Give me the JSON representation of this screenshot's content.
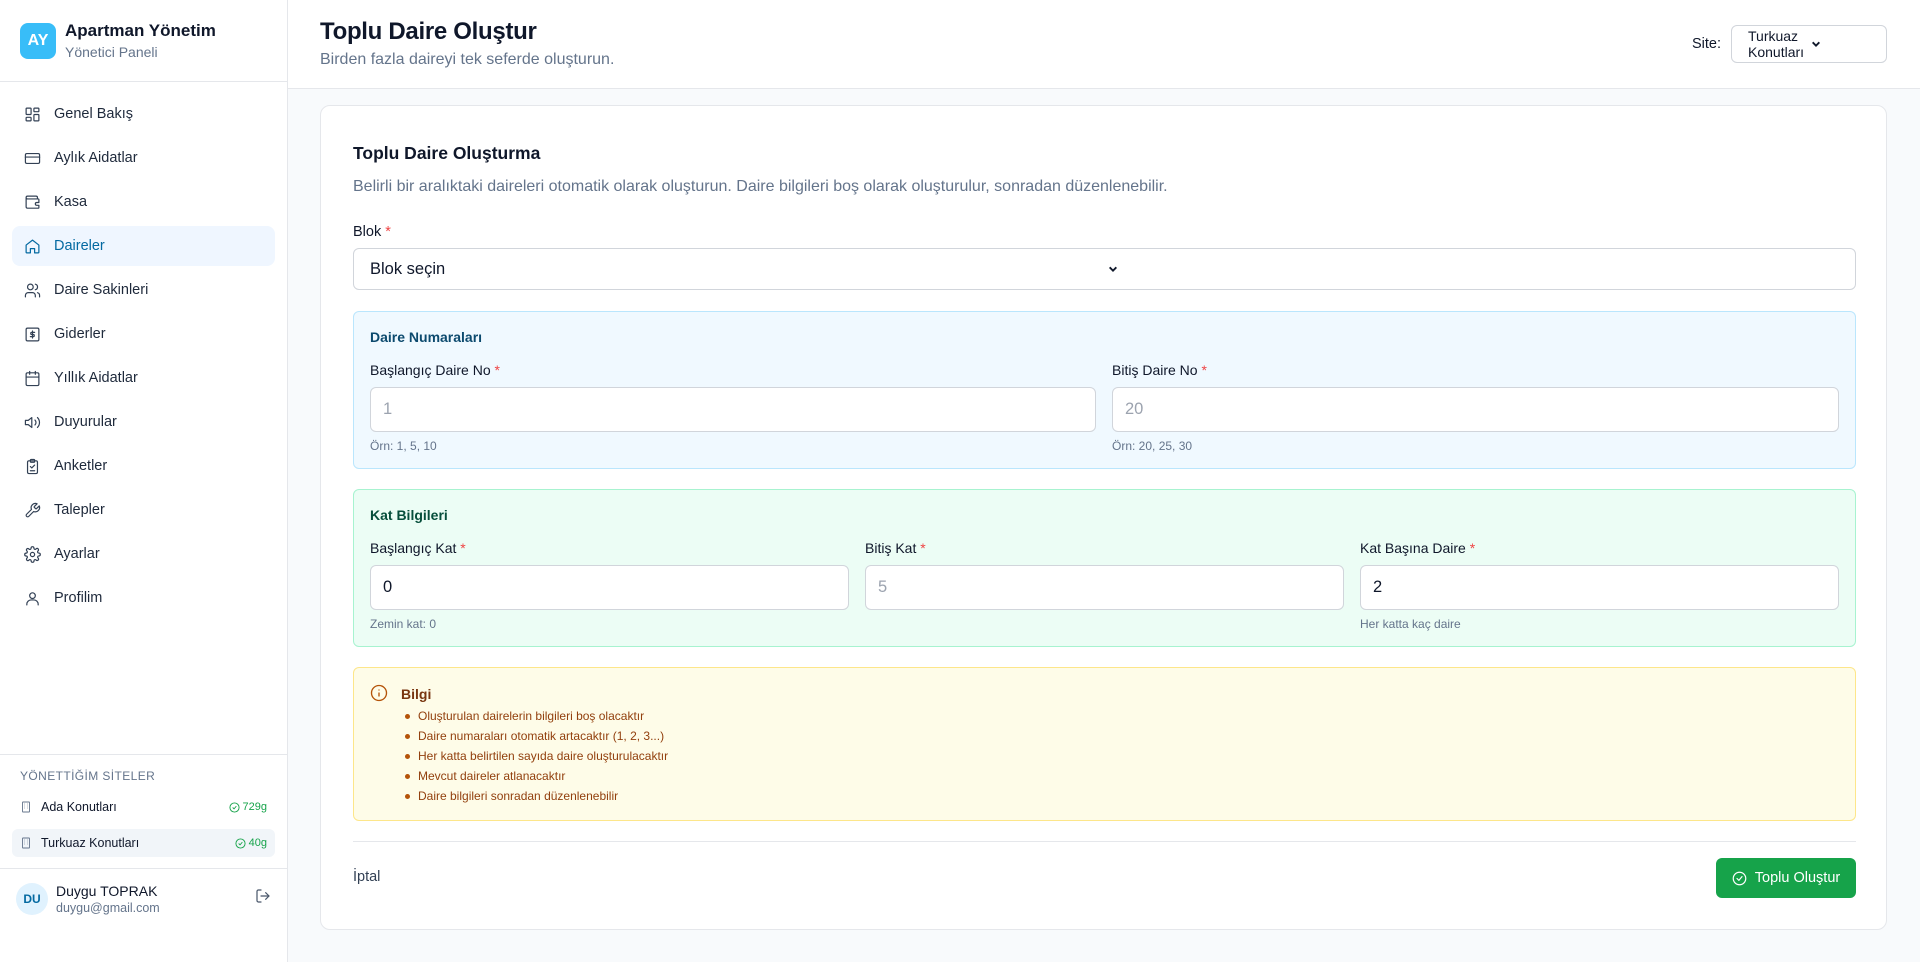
{
  "brand": {
    "initials": "AY",
    "title": "Apartman Yönetim",
    "subtitle": "Yönetici Paneli"
  },
  "sidebar": {
    "items": [
      {
        "label": "Genel Bakış",
        "icon": "dashboard-icon"
      },
      {
        "label": "Aylık Aidatlar",
        "icon": "credit-card-icon"
      },
      {
        "label": "Kasa",
        "icon": "wallet-icon"
      },
      {
        "label": "Daireler",
        "icon": "home-icon",
        "active": true
      },
      {
        "label": "Daire Sakinleri",
        "icon": "users-icon"
      },
      {
        "label": "Giderler",
        "icon": "dollar-icon"
      },
      {
        "label": "Yıllık Aidatlar",
        "icon": "calendar-icon"
      },
      {
        "label": "Duyurular",
        "icon": "megaphone-icon"
      },
      {
        "label": "Anketler",
        "icon": "clipboard-icon"
      },
      {
        "label": "Talepler",
        "icon": "wrench-icon"
      },
      {
        "label": "Ayarlar",
        "icon": "gear-icon"
      },
      {
        "label": "Profilim",
        "icon": "user-icon"
      }
    ]
  },
  "sites": {
    "title": "YÖNETTİĞİM SİTELER",
    "items": [
      {
        "name": "Ada Konutları",
        "days": "729g"
      },
      {
        "name": "Turkuaz Konutları",
        "days": "40g",
        "active": true
      }
    ]
  },
  "user": {
    "initials": "DU",
    "name": "Duygu TOPRAK",
    "email": "duygu@gmail.com"
  },
  "header": {
    "title": "Toplu Daire Oluştur",
    "subtitle": "Birden fazla daireyi tek seferde oluşturun.",
    "site_label": "Site:",
    "site_value": "Turkuaz Konutları"
  },
  "form": {
    "title": "Toplu Daire Oluşturma",
    "description": "Belirli bir aralıktaki daireleri otomatik olarak oluşturun. Daire bilgileri boş olarak oluşturulur, sonradan düzenlenebilir.",
    "blok_label": "Blok",
    "blok_value": "Blok seçin",
    "required_mark": "*",
    "numbers": {
      "title": "Daire Numaraları",
      "start_label": "Başlangıç Daire No",
      "start_placeholder": "1",
      "start_hint": "Örn: 1, 5, 10",
      "end_label": "Bitiş Daire No",
      "end_placeholder": "20",
      "end_hint": "Örn: 20, 25, 30"
    },
    "floors": {
      "title": "Kat Bilgileri",
      "start_label": "Başlangıç Kat",
      "start_value": "0",
      "start_hint": "Zemin kat: 0",
      "end_label": "Bitiş Kat",
      "end_placeholder": "5",
      "per_floor_label": "Kat Başına Daire",
      "per_floor_value": "2",
      "per_floor_hint": "Her katta kaç daire"
    },
    "info": {
      "title": "Bilgi",
      "items": [
        "Oluşturulan dairelerin bilgileri boş olacaktır",
        "Daire numaraları otomatik artacaktır (1, 2, 3...)",
        "Her katta belirtilen sayıda daire oluşturulacaktır",
        "Mevcut daireler atlanacaktır",
        "Daire bilgileri sonradan düzenlenebilir"
      ]
    },
    "cancel_label": "İptal",
    "submit_label": "Toplu Oluştur"
  }
}
